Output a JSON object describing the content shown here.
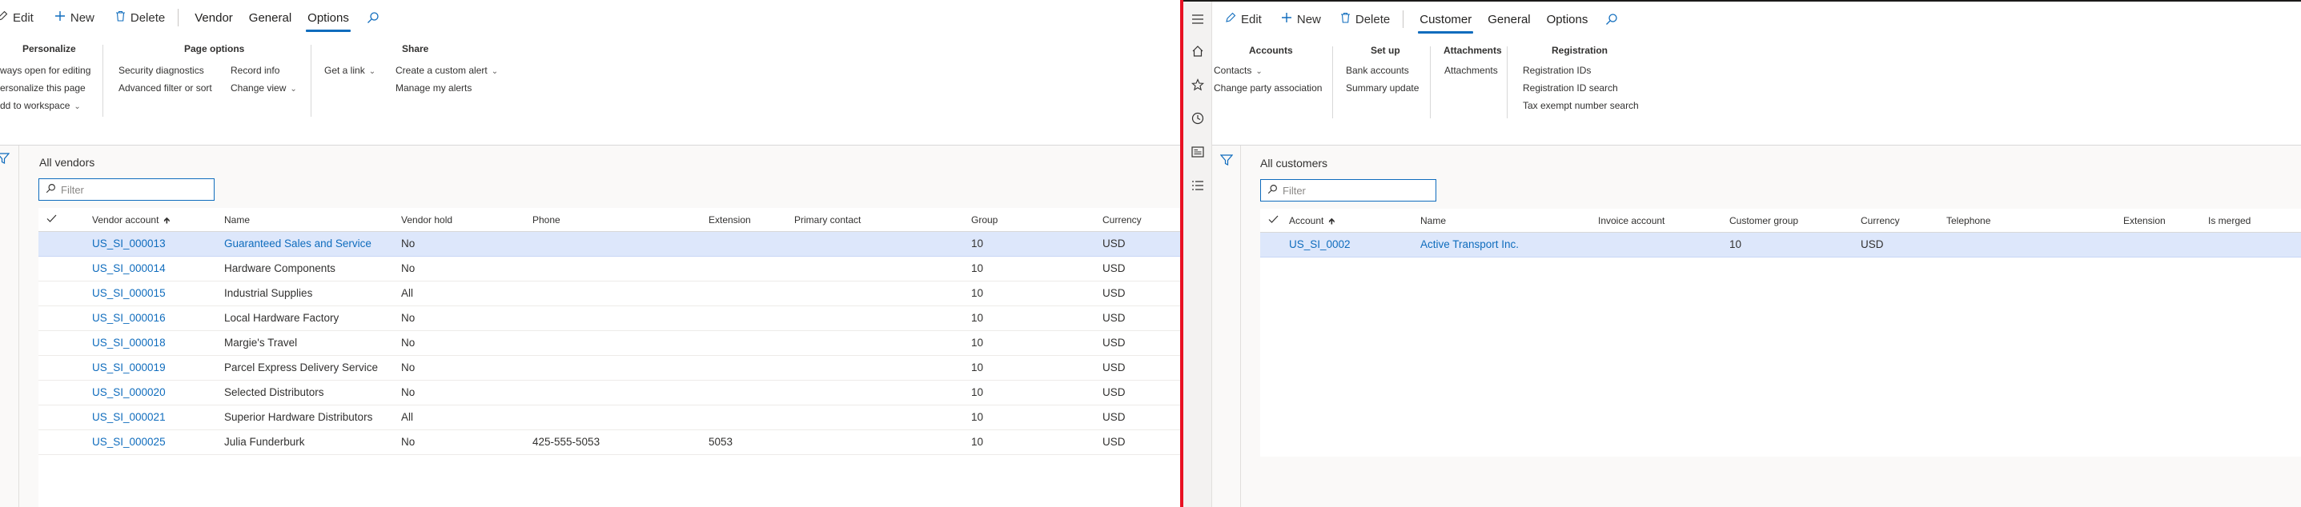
{
  "left": {
    "actionbar": {
      "edit": "Edit",
      "new": "New",
      "delete": "Delete",
      "tabs": [
        "Vendor",
        "General",
        "Options"
      ]
    },
    "ribbon": {
      "personalize": {
        "title": "Personalize",
        "items": [
          "ways open for editing",
          "ersonalize this page",
          "dd to workspace"
        ]
      },
      "page_options": {
        "title": "Page options",
        "items": [
          "Security diagnostics",
          "Advanced filter or sort",
          "Record info",
          "Change view"
        ]
      },
      "getlink": "Get a link",
      "share": {
        "title": "Share",
        "items": [
          "Create a custom alert",
          "Manage my alerts"
        ]
      }
    },
    "grid": {
      "title": "All vendors",
      "filter_placeholder": "Filter",
      "columns": [
        "Vendor account",
        "Name",
        "Vendor hold",
        "Phone",
        "Extension",
        "Primary contact",
        "Group",
        "Currency"
      ],
      "rows": [
        {
          "account": "US_SI_000013",
          "name": "Guaranteed Sales and Service",
          "hold": "No",
          "phone": "",
          "ext": "",
          "contact": "",
          "group": "10",
          "currency": "USD"
        },
        {
          "account": "US_SI_000014",
          "name": "Hardware Components",
          "hold": "No",
          "phone": "",
          "ext": "",
          "contact": "",
          "group": "10",
          "currency": "USD"
        },
        {
          "account": "US_SI_000015",
          "name": "Industrial Supplies",
          "hold": "All",
          "phone": "",
          "ext": "",
          "contact": "",
          "group": "10",
          "currency": "USD"
        },
        {
          "account": "US_SI_000016",
          "name": "Local Hardware Factory",
          "hold": "No",
          "phone": "",
          "ext": "",
          "contact": "",
          "group": "10",
          "currency": "USD"
        },
        {
          "account": "US_SI_000018",
          "name": "Margie's Travel",
          "hold": "No",
          "phone": "",
          "ext": "",
          "contact": "",
          "group": "10",
          "currency": "USD"
        },
        {
          "account": "US_SI_000019",
          "name": "Parcel Express Delivery Service",
          "hold": "No",
          "phone": "",
          "ext": "",
          "contact": "",
          "group": "10",
          "currency": "USD"
        },
        {
          "account": "US_SI_000020",
          "name": "Selected Distributors",
          "hold": "No",
          "phone": "",
          "ext": "",
          "contact": "",
          "group": "10",
          "currency": "USD"
        },
        {
          "account": "US_SI_000021",
          "name": "Superior Hardware Distributors",
          "hold": "All",
          "phone": "",
          "ext": "",
          "contact": "",
          "group": "10",
          "currency": "USD"
        },
        {
          "account": "US_SI_000025",
          "name": "Julia Funderburk",
          "hold": "No",
          "phone": "425-555-5053",
          "ext": "5053",
          "contact": "",
          "group": "10",
          "currency": "USD"
        }
      ]
    }
  },
  "right": {
    "actionbar": {
      "edit": "Edit",
      "new": "New",
      "delete": "Delete",
      "tabs": [
        "Customer",
        "General",
        "Options"
      ]
    },
    "ribbon": {
      "accounts": {
        "title": "Accounts",
        "items": [
          "Contacts",
          "Change party association"
        ]
      },
      "setup": {
        "title": "Set up",
        "items": [
          "Bank accounts",
          "Summary update"
        ]
      },
      "attachments": {
        "title": "Attachments",
        "items": [
          "Attachments"
        ]
      },
      "registration": {
        "title": "Registration",
        "items": [
          "Registration IDs",
          "Registration ID search",
          "Tax exempt number search"
        ]
      }
    },
    "grid": {
      "title": "All customers",
      "filter_placeholder": "Filter",
      "columns": [
        "Account",
        "Name",
        "Invoice account",
        "Customer group",
        "Currency",
        "Telephone",
        "Extension",
        "Is merged"
      ],
      "rows": [
        {
          "account": "US_SI_0002",
          "name": "Active Transport Inc.",
          "invoice": "",
          "group": "10",
          "currency": "USD",
          "phone": "",
          "ext": "",
          "merged": ""
        }
      ]
    }
  },
  "colors": {
    "accent": "#0f6cbd",
    "divider": "#e81123",
    "selected_row": "#dde7fb"
  },
  "icons": [
    "edit-icon",
    "add-icon",
    "delete-icon",
    "search-icon",
    "filter-icon",
    "checkmark-icon",
    "hamburger-icon",
    "home-icon",
    "star-icon",
    "clock-icon",
    "workspace-icon",
    "list-icon",
    "chevron-down-icon",
    "sort-up-arrow-icon"
  ]
}
